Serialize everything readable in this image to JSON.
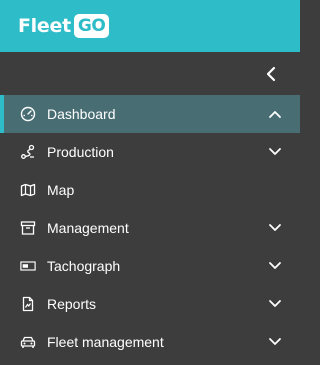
{
  "brand": {
    "name_part1": "Fleet",
    "name_part2": "GO"
  },
  "colors": {
    "accent": "#2ebcc8",
    "sidebar_bg": "#3d3d3d",
    "active_bg": "#486e73",
    "text": "#ffffff"
  },
  "collapse_button": {
    "icon": "chevron-left-icon"
  },
  "menu": [
    {
      "label": "Dashboard",
      "icon": "speedometer-icon",
      "active": true,
      "expanded": true
    },
    {
      "label": "Production",
      "icon": "route-icon",
      "active": false,
      "expanded": false
    },
    {
      "label": "Map",
      "icon": "map-icon",
      "active": false,
      "expanded": false
    },
    {
      "label": "Management",
      "icon": "archive-box-icon",
      "active": false,
      "expanded": false
    },
    {
      "label": "Tachograph",
      "icon": "tachograph-card-icon",
      "active": false,
      "expanded": false
    },
    {
      "label": "Reports",
      "icon": "report-file-icon",
      "active": false,
      "expanded": false
    },
    {
      "label": "Fleet management",
      "icon": "car-icon",
      "active": false,
      "expanded": false
    }
  ]
}
